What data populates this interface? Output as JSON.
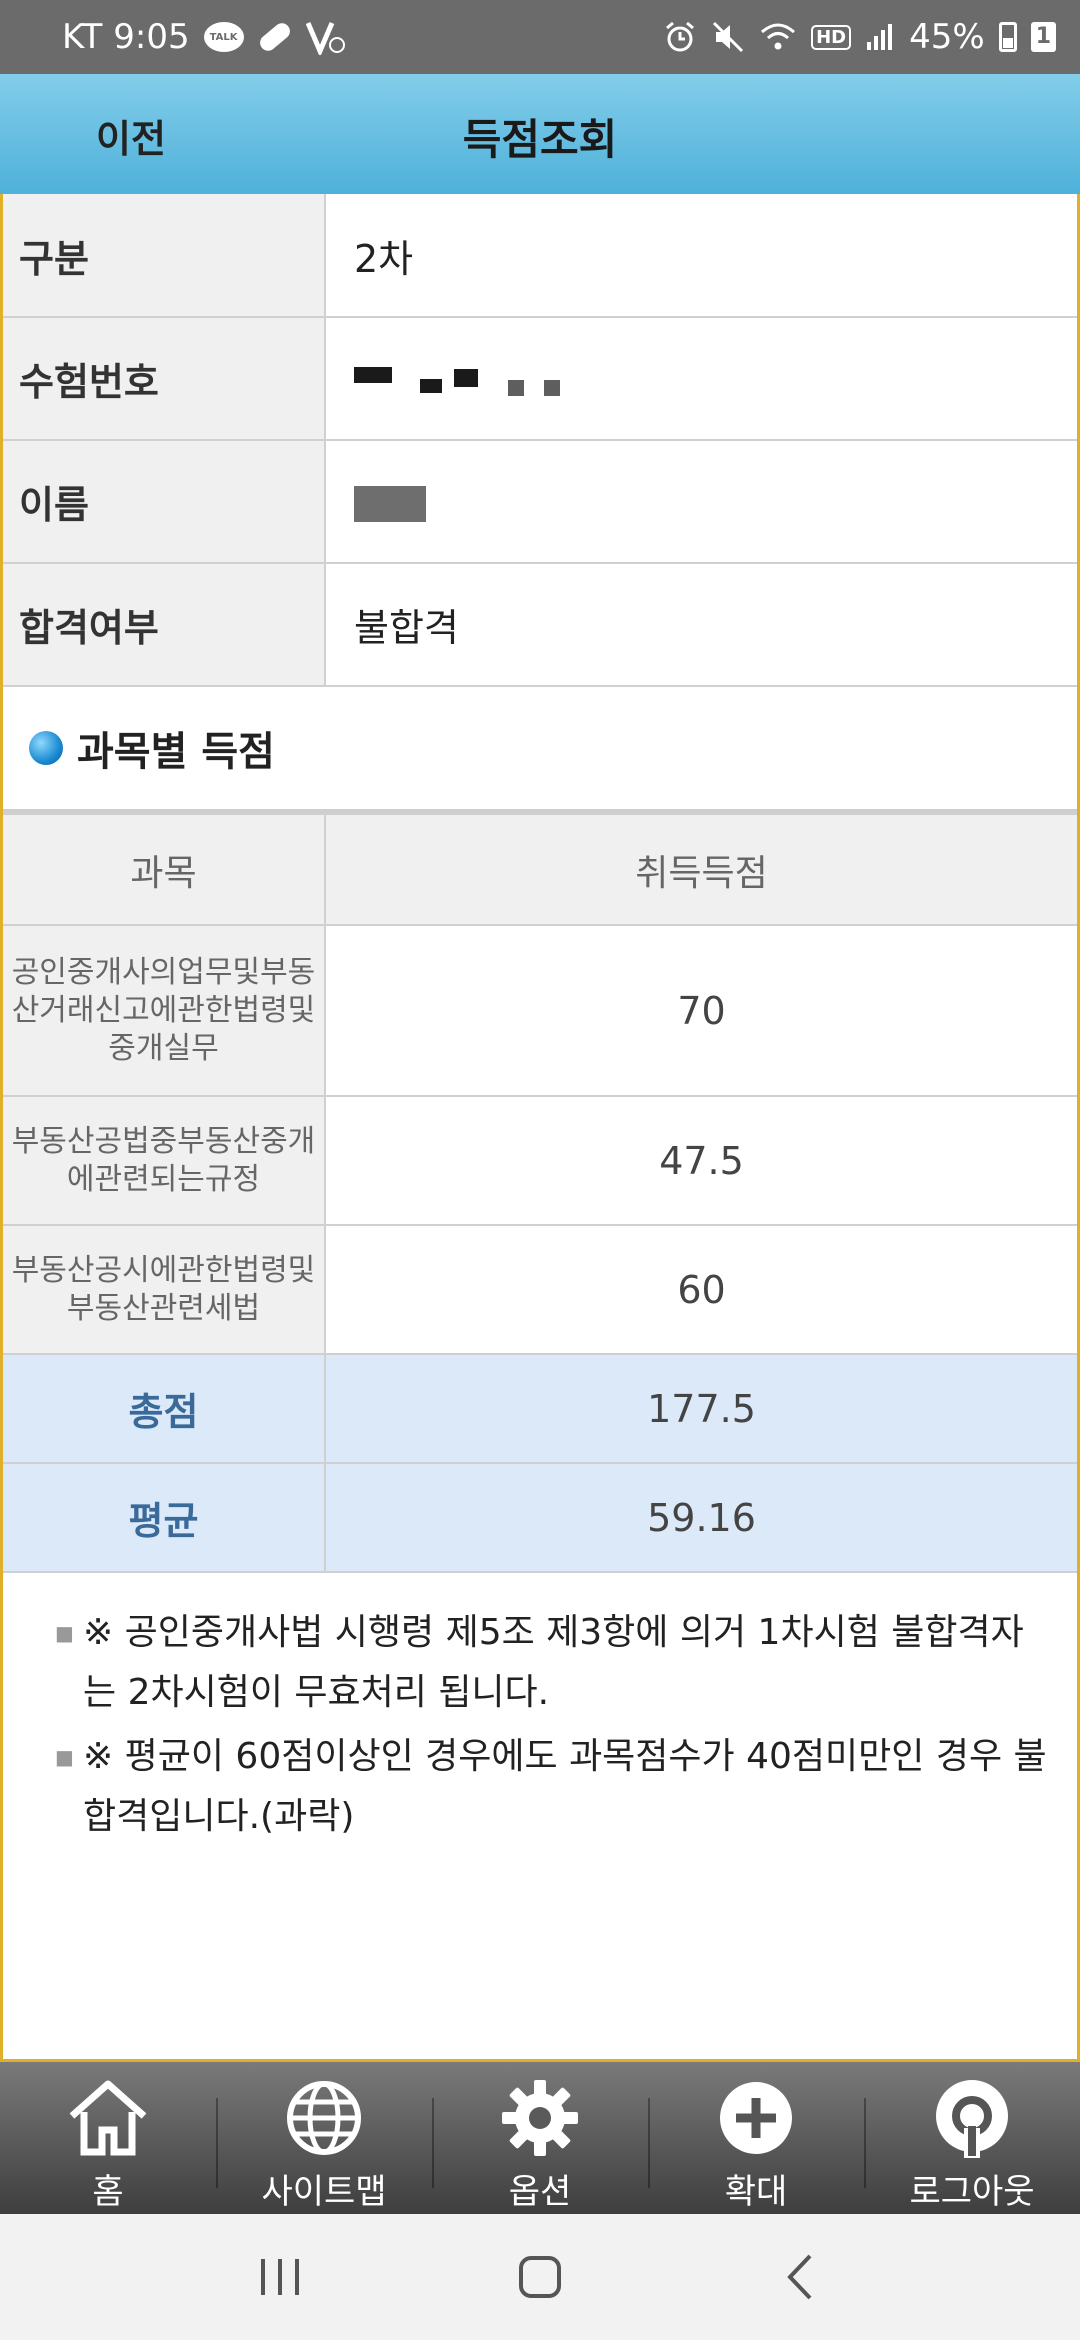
{
  "status_bar": {
    "carrier_time": "KT 9:05",
    "kakao_label": "TALK",
    "battery_percent": "45%",
    "notification_count": "1",
    "hd_label": "HD"
  },
  "header": {
    "back_label": "이전",
    "title": "득점조회"
  },
  "info": [
    {
      "label": "구분",
      "value": "2차"
    },
    {
      "label": "수험번호",
      "value": ""
    },
    {
      "label": "이름",
      "value": ""
    },
    {
      "label": "합격여부",
      "value": "불합격"
    }
  ],
  "section": {
    "title": "과목별 득점"
  },
  "scores": {
    "headers": [
      "과목",
      "취득득점"
    ],
    "subjects": [
      {
        "name": "공인중개사의업무및부동산거래신고에관한법령및중개실무",
        "score": "70"
      },
      {
        "name": "부동산공법중부동산중개에관련되는규정",
        "score": "47.5"
      },
      {
        "name": "부동산공시에관한법령및부동산관련세법",
        "score": "60"
      }
    ],
    "total_label": "총점",
    "total_value": "177.5",
    "average_label": "평균",
    "average_value": "59.16"
  },
  "notes": [
    "※ 공인중개사법 시행령 제5조 제3항에 의거 1차시험 불합격자는 2차시험이 무효처리 됩니다.",
    "※ 평균이 60점이상인 경우에도 과목점수가 40점미만인 경우 불합격입니다.(과락)"
  ],
  "toolbar": [
    {
      "label": "홈",
      "icon": "home-icon"
    },
    {
      "label": "사이트맵",
      "icon": "globe-icon"
    },
    {
      "label": "옵션",
      "icon": "gear-icon"
    },
    {
      "label": "확대",
      "icon": "plus-circle-icon"
    },
    {
      "label": "로그아웃",
      "icon": "power-icon"
    }
  ],
  "colors": {
    "header_top": "#82cdea",
    "header_bottom": "#4fb1da",
    "summary_row": "#dce9f8",
    "summary_label": "#3a6a99",
    "frame_border": "#e0b02a"
  }
}
